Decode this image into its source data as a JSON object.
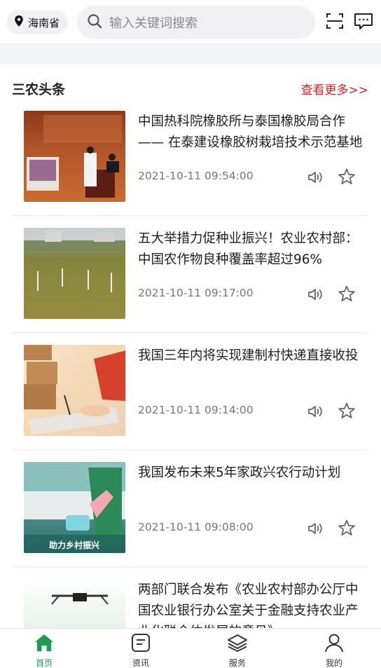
{
  "header": {
    "location": "海南省",
    "search_placeholder": "输入关键词搜索",
    "icons": {
      "location": "location-pin-icon",
      "search": "search-icon",
      "scan": "scan-icon",
      "message": "message-icon"
    }
  },
  "section": {
    "title": "三农头条",
    "more_label": "查看更多>>",
    "accent_color": "#e02020"
  },
  "news": [
    {
      "title": "中国热科院橡胶所与泰国橡胶局合作—— 在泰建设橡胶树栽培技术示范基地",
      "time": "2021-10-11 09:54:00"
    },
    {
      "title": "五大举措力促种业振兴！农业农村部：中国农作物良种覆盖率超过96%",
      "time": "2021-10-11 09:17:00"
    },
    {
      "title": "我国三年内将实现建制村快递直接收投",
      "time": "2021-10-11 09:14:00"
    },
    {
      "title": "我国发布未来5年家政兴农行动计划",
      "time": "2021-10-11 09:08:00",
      "thumb_caption": "助力乡村振兴"
    },
    {
      "title": "两部门联合发布《农业农村部办公厅中国农业银行办公室关于金融支持农业产业化联合体发展的意见》",
      "time": ""
    }
  ],
  "tabbar": {
    "active_color": "#1c9c55",
    "items": [
      {
        "label": "首页",
        "icon": "home-icon",
        "active": true
      },
      {
        "label": "资讯",
        "icon": "news-icon",
        "active": false
      },
      {
        "label": "服务",
        "icon": "layers-icon",
        "active": false
      },
      {
        "label": "我的",
        "icon": "user-icon",
        "active": false
      }
    ]
  }
}
